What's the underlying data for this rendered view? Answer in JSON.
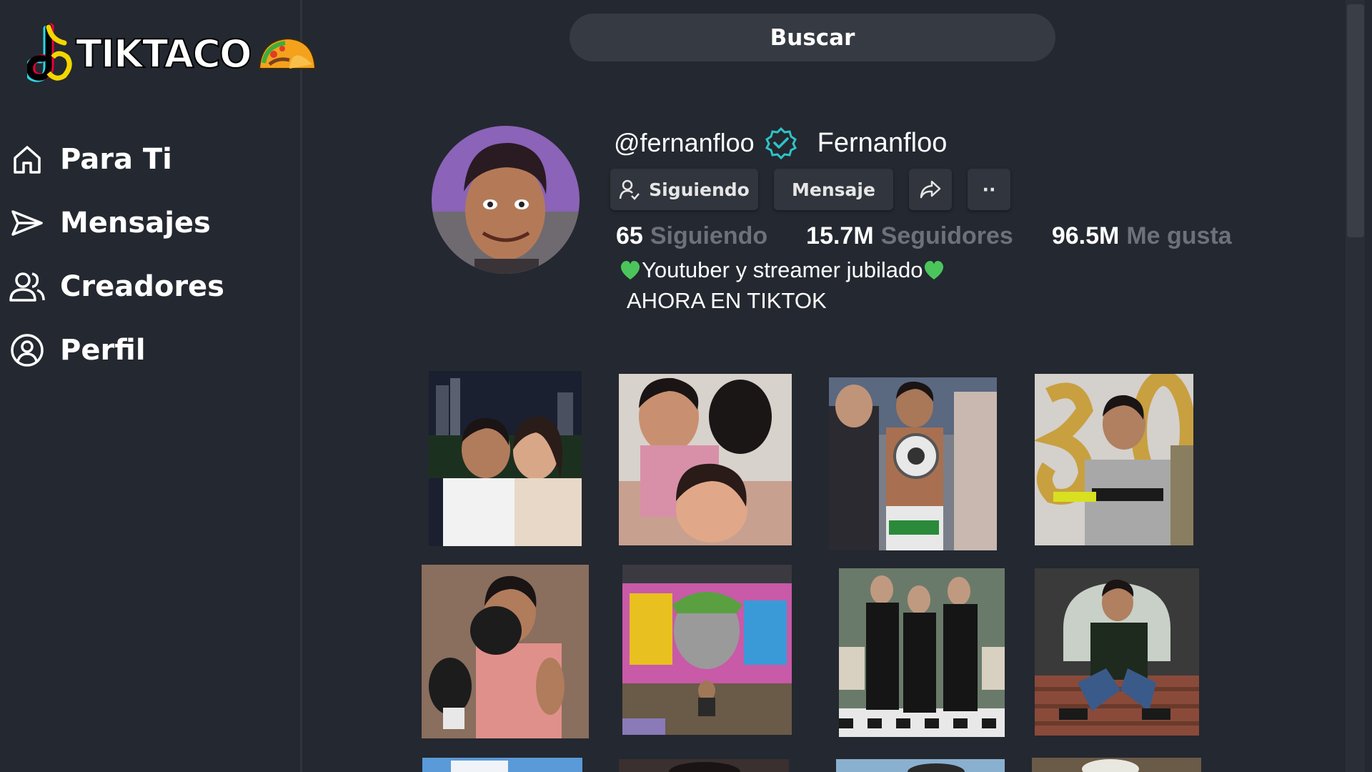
{
  "app": {
    "logo_text": "TIKTACO"
  },
  "sidebar": {
    "items": [
      {
        "label": "Para Ti",
        "icon": "home-icon"
      },
      {
        "label": "Mensajes",
        "icon": "send-icon"
      },
      {
        "label": "Creadores",
        "icon": "users-icon"
      },
      {
        "label": "Perfil",
        "icon": "profile-circle-icon"
      }
    ]
  },
  "search": {
    "label": "Buscar"
  },
  "profile": {
    "handle": "@fernanfloo",
    "display_name": "Fernanfloo",
    "verified": true,
    "actions": {
      "follow_label": "Siguiendo",
      "message_label": "Mensaje",
      "share_icon": "share-arrow-icon",
      "more_label": "··"
    },
    "stats": [
      {
        "value": "65",
        "label": "Siguiendo"
      },
      {
        "value": "15.7M",
        "label": "Seguidores"
      },
      {
        "value": "96.5M",
        "label": "Me gusta"
      }
    ],
    "bio": {
      "line1": "Youtuber y streamer jubilado",
      "line2": "AHORA EN TIKTOK"
    }
  },
  "colors": {
    "background": "#242830",
    "muted_text": "#6c717a",
    "button_bg": "#31353d",
    "search_bg": "#363a43",
    "verified": "#2ec4c7",
    "heart": "#4cc45c"
  },
  "videos": [
    {
      "description": "couple selfie at night with city skyline"
    },
    {
      "description": "selfie with woman and black dog"
    },
    {
      "description": "boxer holding championship belt"
    },
    {
      "description": "holding gold 30 balloons, El Salvador shirt"
    },
    {
      "description": "boxing glove pose"
    },
    {
      "description": "graffiti mural with person sitting"
    },
    {
      "description": "three people in suits"
    },
    {
      "description": "sitting on brick steps in green jacket"
    },
    {
      "description": "thumbnail partially visible"
    },
    {
      "description": "thumbnail partially visible"
    },
    {
      "description": "thumbnail partially visible"
    },
    {
      "description": "thumbnail partially visible"
    }
  ]
}
